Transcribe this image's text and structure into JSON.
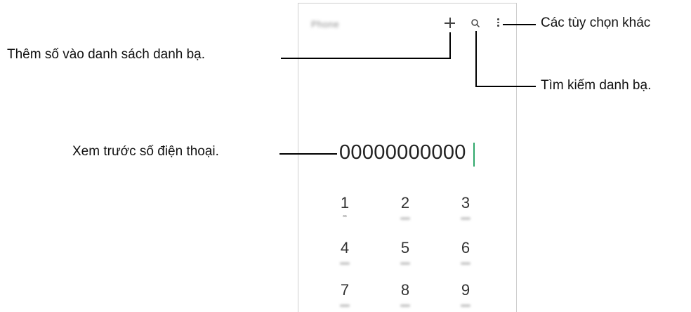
{
  "phone_app": {
    "title": "Phone",
    "number_preview": "00000000000",
    "keys": [
      {
        "digit": "1",
        "sub": "∞"
      },
      {
        "digit": "2",
        "sub": ""
      },
      {
        "digit": "3",
        "sub": ""
      },
      {
        "digit": "4",
        "sub": ""
      },
      {
        "digit": "5",
        "sub": ""
      },
      {
        "digit": "6",
        "sub": ""
      },
      {
        "digit": "7",
        "sub": ""
      },
      {
        "digit": "8",
        "sub": ""
      },
      {
        "digit": "9",
        "sub": ""
      }
    ],
    "accent_color": "#2fa76a"
  },
  "callouts": {
    "more_options": "Các tùy chọn khác",
    "add_contact": "Thêm số vào danh sách danh bạ.",
    "search_contacts": "Tìm kiếm danh bạ.",
    "number_preview": "Xem trước số điện thoại."
  },
  "icons": [
    "plus-icon",
    "search-icon",
    "more-options-icon"
  ]
}
